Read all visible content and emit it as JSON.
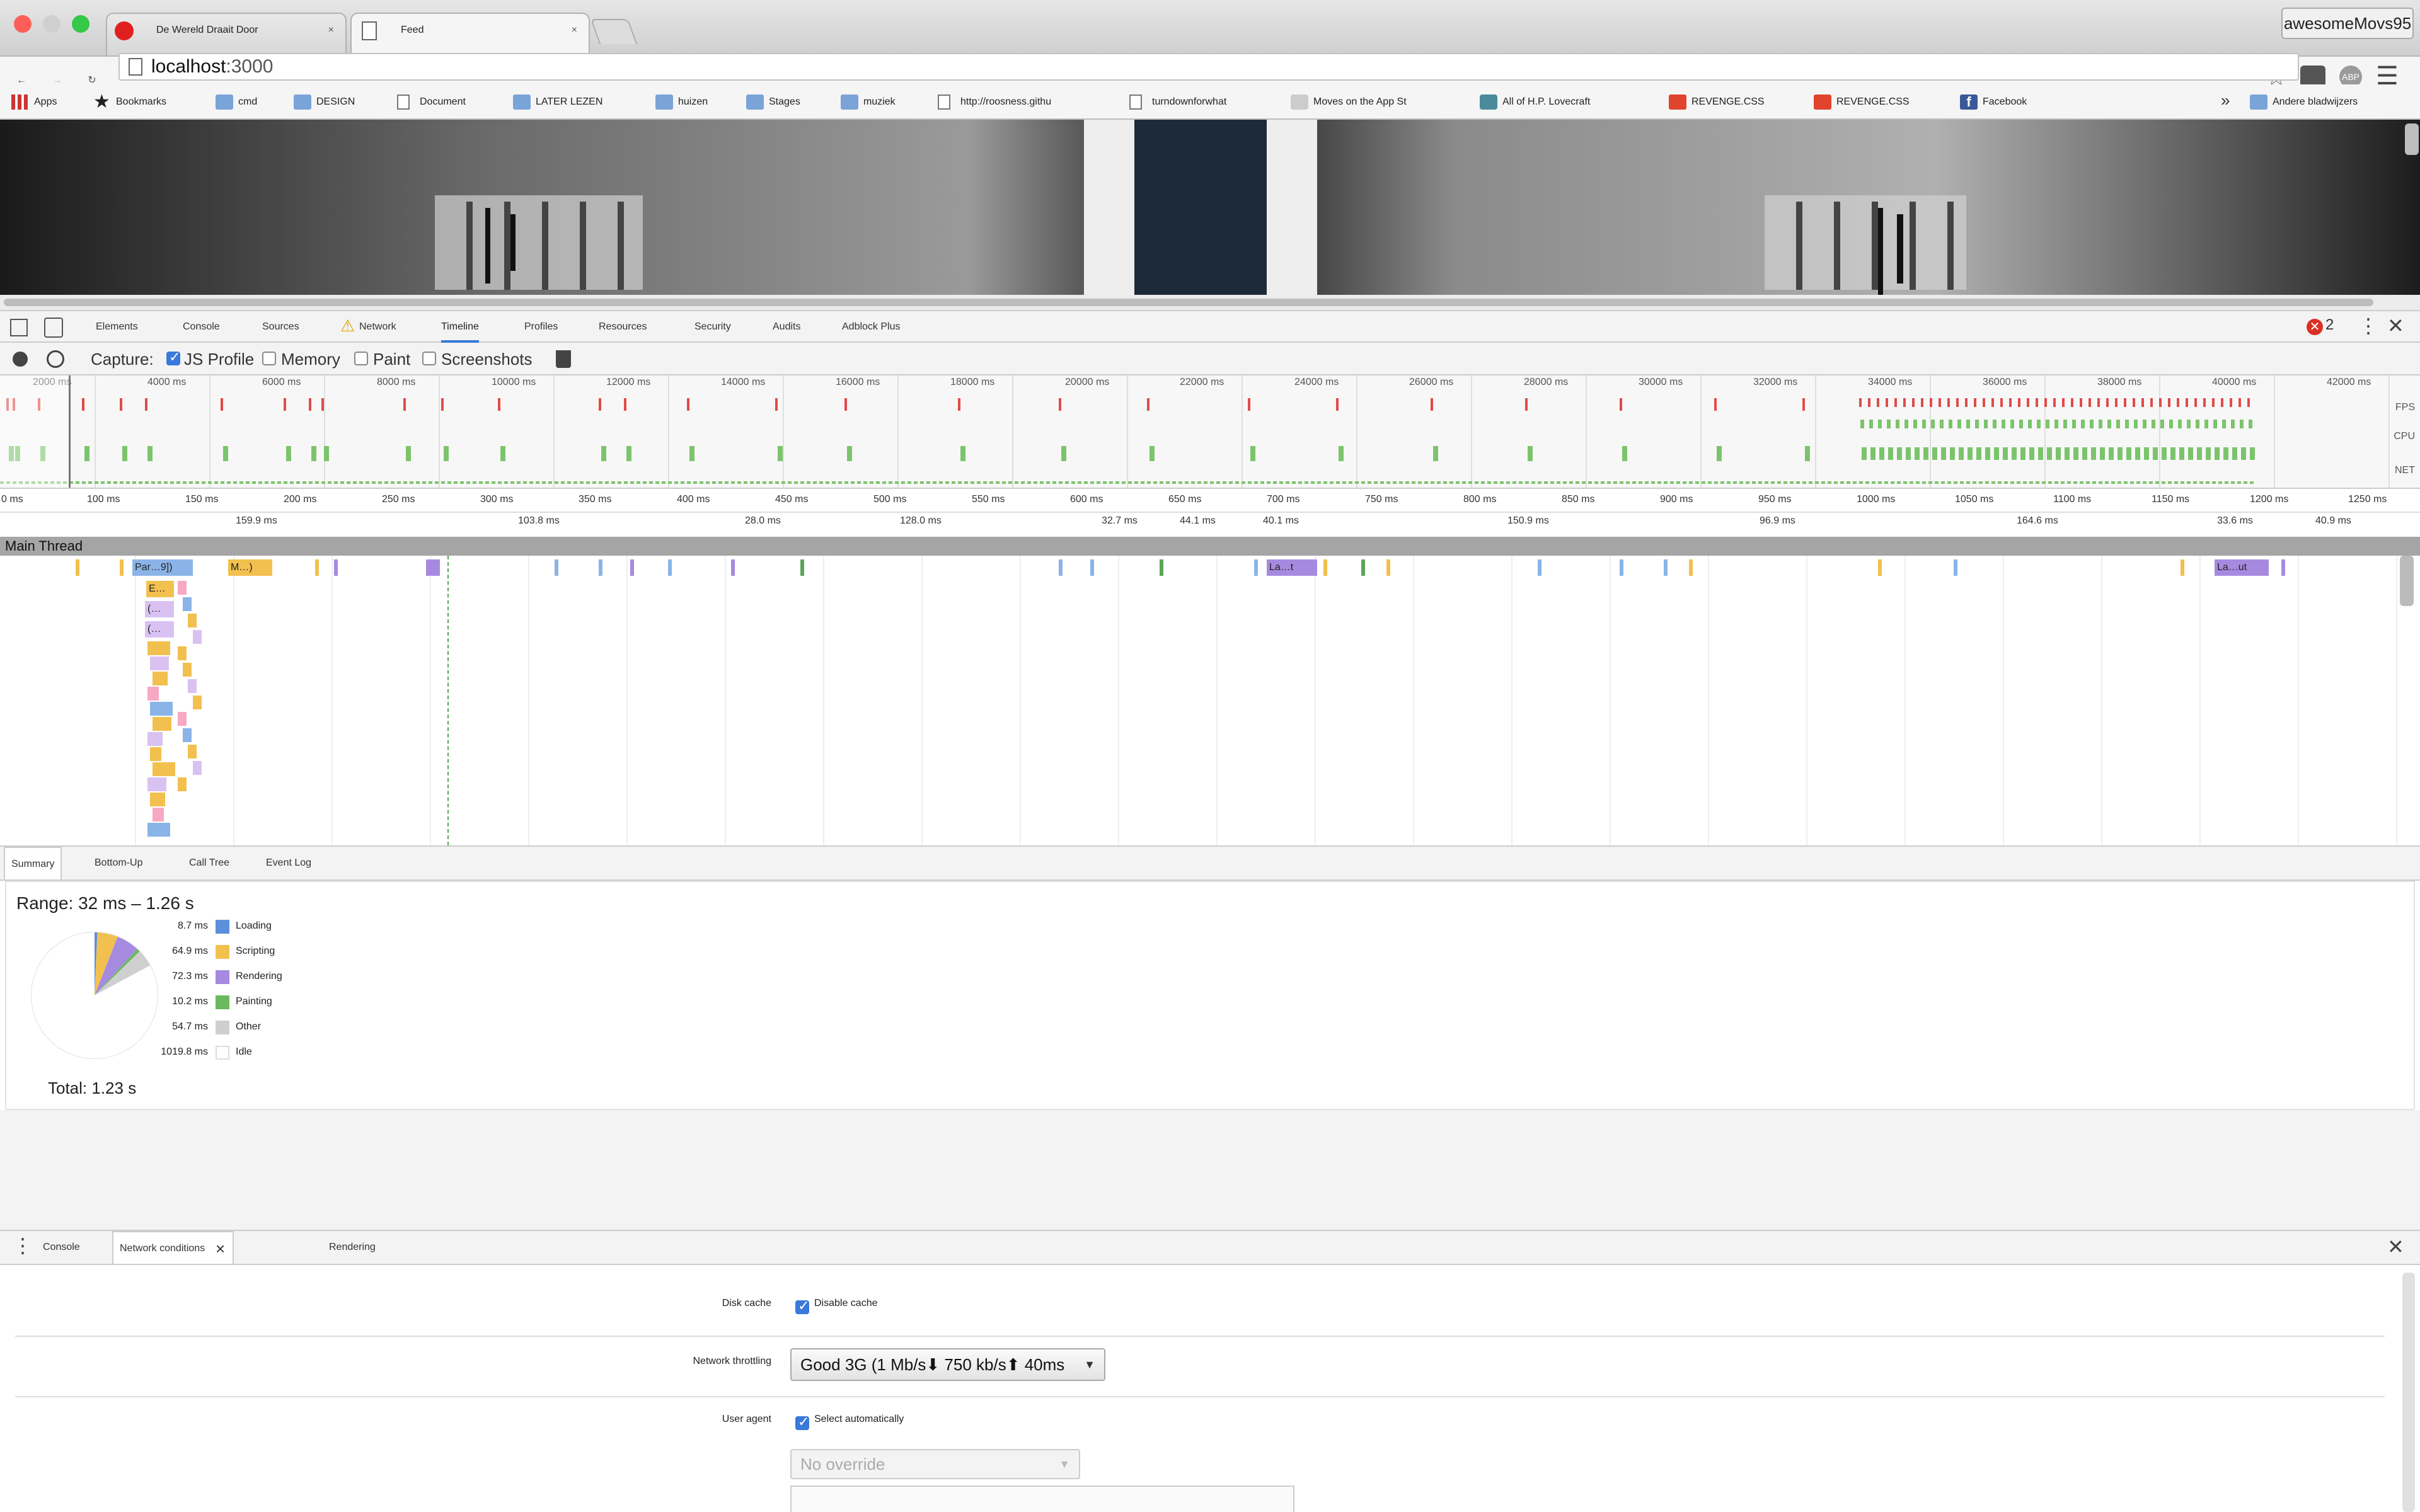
{
  "browser": {
    "tabs": [
      {
        "title": "De Wereld Draait Door",
        "close": "×"
      },
      {
        "title": "Feed",
        "close": "×"
      }
    ],
    "profile": "awesomeMovs95",
    "url_host": "localhost",
    "url_rest": ":3000",
    "bookmarks": [
      {
        "label": "Apps",
        "icon": "apps-icon"
      },
      {
        "label": "Bookmarks",
        "icon": "star-icon"
      },
      {
        "label": "cmd",
        "icon": "folder-icon"
      },
      {
        "label": "DESIGN",
        "icon": "folder-icon"
      },
      {
        "label": "Document",
        "icon": "page-icon"
      },
      {
        "label": "LATER LEZEN",
        "icon": "folder-icon"
      },
      {
        "label": "huizen",
        "icon": "folder-icon"
      },
      {
        "label": "Stages",
        "icon": "folder-icon"
      },
      {
        "label": "muziek",
        "icon": "folder-icon"
      },
      {
        "label": "http://roosness.githu",
        "icon": "page-icon"
      },
      {
        "label": "turndownforwhat",
        "icon": "page-icon"
      },
      {
        "label": "Moves on the App St",
        "icon": "app-store-icon"
      },
      {
        "label": "All of H.P. Lovecraft",
        "icon": "site-icon"
      },
      {
        "label": "REVENGE.CSS",
        "icon": "revenge-icon"
      },
      {
        "label": "REVENGE.CSS",
        "icon": "revenge-icon"
      },
      {
        "label": "Facebook",
        "icon": "facebook-icon"
      }
    ],
    "bookmarks_more": "»",
    "other_bookmarks": "Andere bladwijzers"
  },
  "devtools": {
    "tabs": [
      "Elements",
      "Console",
      "Sources",
      "Network",
      "Timeline",
      "Profiles",
      "Resources",
      "Security",
      "Audits",
      "Adblock Plus"
    ],
    "active_tab": "Timeline",
    "error_count": "2",
    "capture_label": "Capture:",
    "capture_options": [
      {
        "label": "JS Profile",
        "checked": true
      },
      {
        "label": "Memory",
        "checked": false
      },
      {
        "label": "Paint",
        "checked": false
      },
      {
        "label": "Screenshots",
        "checked": false
      }
    ],
    "overview_ticks": [
      "2000 ms",
      "4000 ms",
      "6000 ms",
      "8000 ms",
      "10000 ms",
      "12000 ms",
      "14000 ms",
      "16000 ms",
      "18000 ms",
      "20000 ms",
      "22000 ms",
      "24000 ms",
      "26000 ms",
      "28000 ms",
      "30000 ms",
      "32000 ms",
      "34000 ms",
      "36000 ms",
      "38000 ms",
      "40000 ms",
      "42000 ms"
    ],
    "overview_rows": [
      "FPS",
      "CPU",
      "NET"
    ],
    "ruler_ticks": [
      "0 ms",
      "100 ms",
      "150 ms",
      "200 ms",
      "250 ms",
      "300 ms",
      "350 ms",
      "400 ms",
      "450 ms",
      "500 ms",
      "550 ms",
      "600 ms",
      "650 ms",
      "700 ms",
      "750 ms",
      "800 ms",
      "850 ms",
      "900 ms",
      "950 ms",
      "1000 ms",
      "1050 ms",
      "1100 ms",
      "1150 ms",
      "1200 ms",
      "1250 ms"
    ],
    "frame_durations": [
      "159.9 ms",
      "103.8 ms",
      "28.0 ms",
      "128.0 ms",
      "32.7 ms",
      "44.1 ms",
      "40.1 ms",
      "150.9 ms",
      "96.9 ms",
      "164.6 ms",
      "33.6 ms",
      "40.9 ms"
    ],
    "main_thread_label": "Main Thread",
    "flame_labels": [
      "Par…9])",
      "M…)",
      "E…",
      "(…",
      "(…",
      "La…t",
      "La…ut"
    ],
    "summary_tabs": [
      "Summary",
      "Bottom-Up",
      "Call Tree",
      "Event Log"
    ],
    "summary": {
      "range": "Range: 32 ms – 1.26 s",
      "total": "Total: 1.23 s",
      "categories": [
        {
          "value": "8.7 ms",
          "ms": 8.7,
          "name": "Loading",
          "color": "#5b8fdb"
        },
        {
          "value": "64.9 ms",
          "ms": 64.9,
          "name": "Scripting",
          "color": "#f2c04e"
        },
        {
          "value": "72.3 ms",
          "ms": 72.3,
          "name": "Rendering",
          "color": "#a68ae0"
        },
        {
          "value": "10.2 ms",
          "ms": 10.2,
          "name": "Painting",
          "color": "#6bb95f"
        },
        {
          "value": "54.7 ms",
          "ms": 54.7,
          "name": "Other",
          "color": "#cfcfcf"
        },
        {
          "value": "1019.8 ms",
          "ms": 1019.8,
          "name": "Idle",
          "color": "#ffffff"
        }
      ]
    },
    "drawer_tabs": [
      "Console",
      "Network conditions",
      "Rendering"
    ],
    "network_conditions": {
      "disk_cache_label": "Disk cache",
      "disk_cache_option": "Disable cache",
      "throttling_label": "Network throttling",
      "throttling_value": "Good 3G (1 Mb/s⬇ 750 kb/s⬆ 40ms",
      "user_agent_label": "User agent",
      "user_agent_option": "Select automatically",
      "user_agent_select": "No override"
    }
  }
}
